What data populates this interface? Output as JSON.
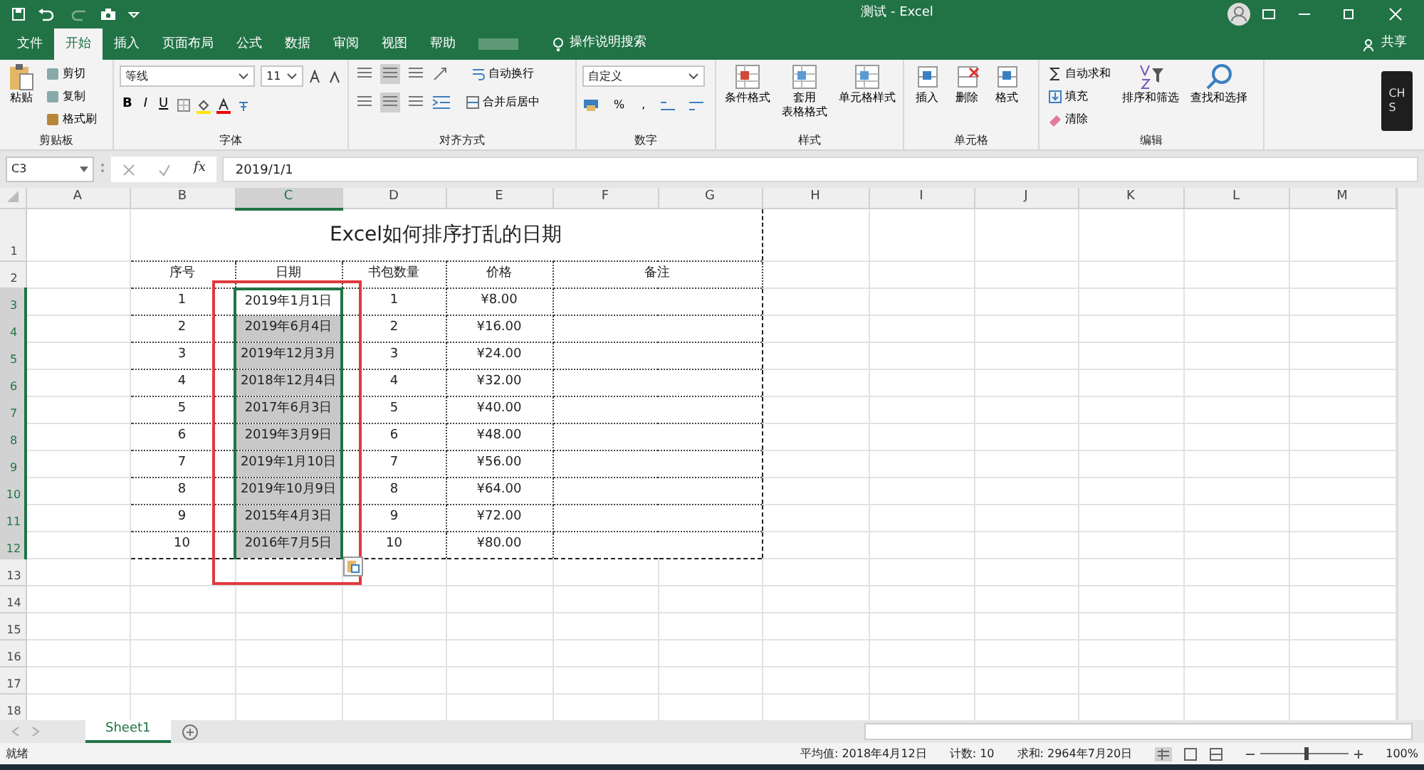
{
  "title_bar": {
    "title": "测试 - Excel"
  },
  "menu_tabs": [
    {
      "label": "文件",
      "selected": false
    },
    {
      "label": "开始",
      "selected": true
    },
    {
      "label": "插入",
      "selected": false
    },
    {
      "label": "页面布局",
      "selected": false
    },
    {
      "label": "公式",
      "selected": false
    },
    {
      "label": "数据",
      "selected": false
    },
    {
      "label": "审阅",
      "selected": false
    },
    {
      "label": "视图",
      "selected": false
    },
    {
      "label": "帮助",
      "selected": false
    }
  ],
  "tell_me": "操作说明搜索",
  "share": "共享",
  "ribbon": {
    "clipboard": {
      "label": "剪贴板",
      "paste": "粘贴",
      "items": [
        "剪切",
        "复制",
        "格式刷"
      ]
    },
    "font": {
      "label": "字体",
      "font_name": "等线",
      "font_size": "11",
      "style_buttons": [
        "B",
        "I",
        "U"
      ]
    },
    "alignment": {
      "label": "对齐方式",
      "wrap": "自动换行",
      "merge": "合并后居中"
    },
    "number": {
      "label": "数字",
      "format": "自定义",
      "symbols": [
        "%",
        ","
      ]
    },
    "styles": {
      "label": "样式",
      "buttons": [
        [
          "条件格式"
        ],
        [
          "套用",
          "表格格式"
        ],
        [
          "单元格样式"
        ]
      ]
    },
    "cells": {
      "label": "单元格",
      "buttons": [
        "插入",
        "删除",
        "格式"
      ]
    },
    "editing": {
      "label": "编辑",
      "items": [
        "自动求和",
        "填充",
        "清除"
      ],
      "buttons": [
        "排序和筛选",
        "查找和选择"
      ]
    },
    "ime": [
      "CH",
      "S"
    ]
  },
  "formula_bar": {
    "name_box": "C3",
    "fx": "fx",
    "formula": "2019/1/1"
  },
  "sheet": {
    "columns": [
      {
        "label": "A",
        "selected": false
      },
      {
        "label": "B",
        "selected": false
      },
      {
        "label": "C",
        "selected": true
      },
      {
        "label": "D",
        "selected": false
      },
      {
        "label": "E",
        "selected": false
      },
      {
        "label": "F",
        "selected": false
      },
      {
        "label": "G",
        "selected": false
      },
      {
        "label": "H",
        "selected": false
      },
      {
        "label": "I",
        "selected": false
      },
      {
        "label": "J",
        "selected": false
      },
      {
        "label": "K",
        "selected": false
      },
      {
        "label": "L",
        "selected": false
      },
      {
        "label": "M",
        "selected": false
      }
    ],
    "row_numbers": [
      {
        "label": "1",
        "selected": false
      },
      {
        "label": "2",
        "selected": false
      },
      {
        "label": "3",
        "selected": true
      },
      {
        "label": "4",
        "selected": true
      },
      {
        "label": "5",
        "selected": true
      },
      {
        "label": "6",
        "selected": true
      },
      {
        "label": "7",
        "selected": true
      },
      {
        "label": "8",
        "selected": true
      },
      {
        "label": "9",
        "selected": true
      },
      {
        "label": "10",
        "selected": true
      },
      {
        "label": "11",
        "selected": true
      },
      {
        "label": "12",
        "selected": true
      },
      {
        "label": "13",
        "selected": false
      },
      {
        "label": "14",
        "selected": false
      },
      {
        "label": "15",
        "selected": false
      },
      {
        "label": "16",
        "selected": false
      },
      {
        "label": "17",
        "selected": false
      },
      {
        "label": "18",
        "selected": false
      }
    ],
    "title": "Excel如何排序打乱的日期",
    "headers": [
      "序号",
      "日期",
      "书包数量",
      "价格",
      "备注"
    ],
    "rows": [
      {
        "no": "1",
        "date": "2019年1月1日",
        "selected": true,
        "active": true,
        "qty": "1",
        "price": "¥8.00"
      },
      {
        "no": "2",
        "date": "2019年6月4日",
        "selected": true,
        "active": false,
        "qty": "2",
        "price": "¥16.00"
      },
      {
        "no": "3",
        "date": "2019年12月3月",
        "selected": true,
        "active": false,
        "qty": "3",
        "price": "¥24.00"
      },
      {
        "no": "4",
        "date": "2018年12月4日",
        "selected": true,
        "active": false,
        "qty": "4",
        "price": "¥32.00"
      },
      {
        "no": "5",
        "date": "2017年6月3日",
        "selected": true,
        "active": false,
        "qty": "5",
        "price": "¥40.00"
      },
      {
        "no": "6",
        "date": "2019年3月9日",
        "selected": true,
        "active": false,
        "qty": "6",
        "price": "¥48.00"
      },
      {
        "no": "7",
        "date": "2019年1月10日",
        "selected": true,
        "active": false,
        "qty": "7",
        "price": "¥56.00"
      },
      {
        "no": "8",
        "date": "2019年10月9日",
        "selected": true,
        "active": false,
        "qty": "8",
        "price": "¥64.00"
      },
      {
        "no": "9",
        "date": "2015年4月3日",
        "selected": true,
        "active": false,
        "qty": "9",
        "price": "¥72.00"
      },
      {
        "no": "10",
        "date": "2016年7月5日",
        "selected": true,
        "active": false,
        "qty": "10",
        "price": "¥80.00"
      }
    ]
  },
  "sheet_tabs": [
    {
      "label": "Sheet1",
      "selected": true
    }
  ],
  "status_bar": {
    "state": "就绪",
    "average": "平均值: 2018年4月12日",
    "count": "计数: 10",
    "sum": "求和: 2964年7月20日",
    "zoom": {
      "level": 0.5
    },
    "zoom_text": "100%"
  }
}
